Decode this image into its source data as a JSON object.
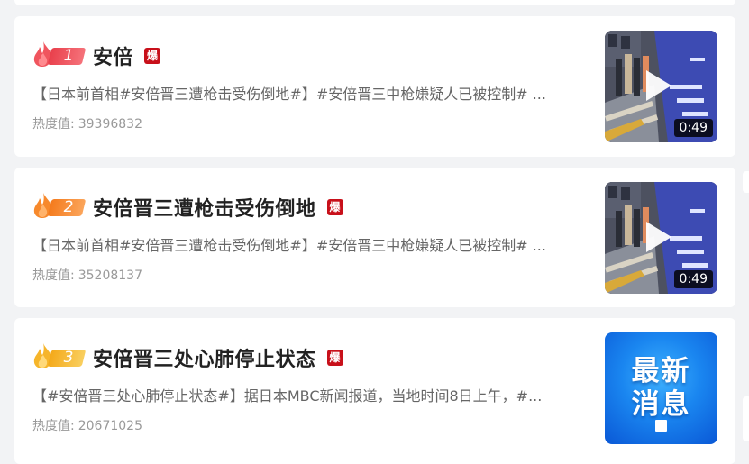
{
  "hot_list": [
    {
      "rank": "1",
      "title": "安倍",
      "badge": "爆",
      "summary": "【日本前首相#安倍晋三遭枪击受伤倒地#】#安倍晋三中枪嫌疑人已被控制# ...",
      "heat_label": "热度值:",
      "heat_value": "39396832",
      "thumb_type": "video",
      "duration": "0:49",
      "rank_color": "#f0555e"
    },
    {
      "rank": "2",
      "title": "安倍晋三遭枪击受伤倒地",
      "badge": "爆",
      "summary": "【日本前首相#安倍晋三遭枪击受伤倒地#】#安倍晋三中枪嫌疑人已被控制# ...",
      "heat_label": "热度值:",
      "heat_value": "35208137",
      "thumb_type": "video",
      "duration": "0:49",
      "rank_color": "#f7892c"
    },
    {
      "rank": "3",
      "title": "安倍晋三处心肺停止状态",
      "badge": "爆",
      "summary": "【#安倍晋三处心肺停止状态#】据日本MBC新闻报道，当地时间8日上午，#...",
      "heat_label": "热度值:",
      "heat_value": "20671025",
      "thumb_type": "image",
      "thumb_text_line1": "最新",
      "thumb_text_line2": "消息",
      "rank_color": "#f6b52a"
    }
  ],
  "colors": {
    "page_background": "#f2f3f5",
    "card_background": "#ffffff",
    "badge_red": "#c8101a"
  }
}
